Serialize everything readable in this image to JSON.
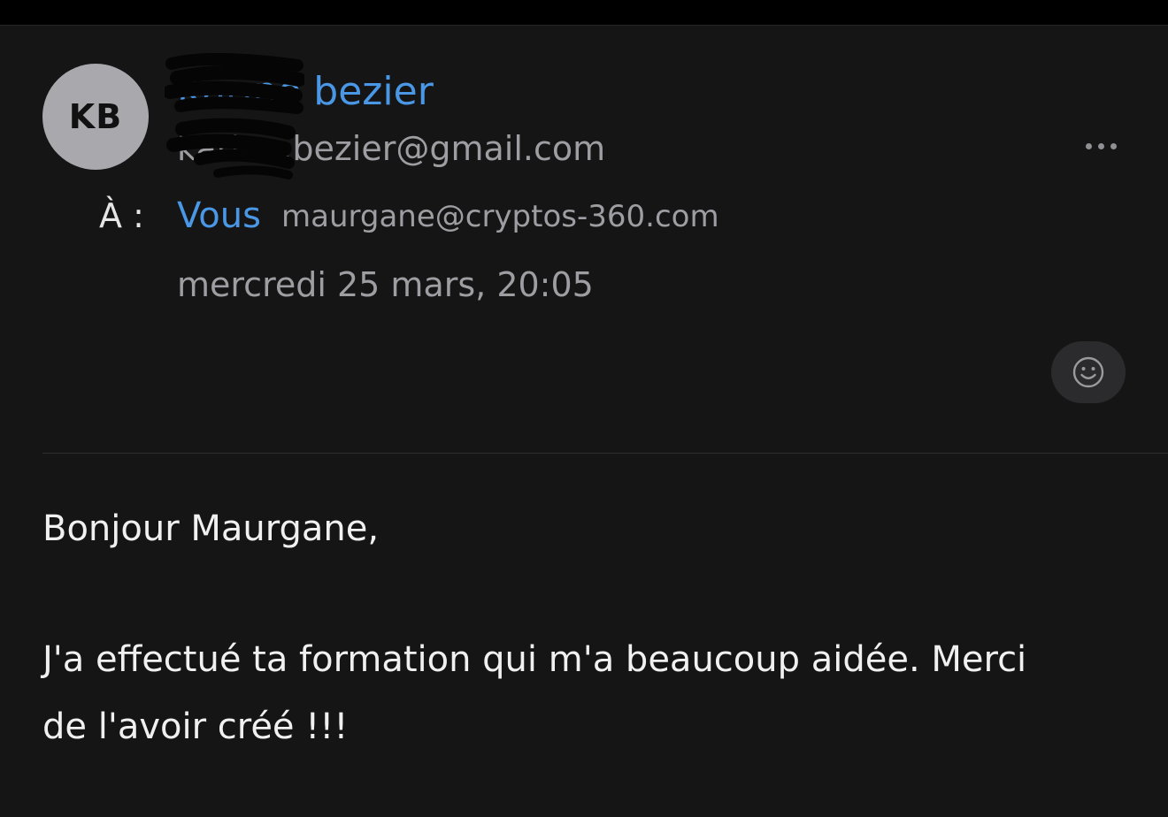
{
  "sender": {
    "initials": "KB",
    "name": "Karine bezier",
    "email": "karine.bezier@gmail.com"
  },
  "recipient": {
    "to_label": "À :",
    "name": "Vous",
    "email": "maurgane@cryptos-360.com"
  },
  "date": "mercredi 25 mars, 20:05",
  "icons": {
    "more": "more-horizontal-icon",
    "reaction": "smiley-icon"
  },
  "message": {
    "greeting": "Bonjour Maurgane,",
    "line1": "J'a effectué ta formation qui m'a beaucoup aidée. Merci",
    "line2": "de l'avoir créé !!!"
  },
  "colors": {
    "accent": "#4a97e6",
    "background": "#151515",
    "secondary_text": "#9d9da2"
  }
}
